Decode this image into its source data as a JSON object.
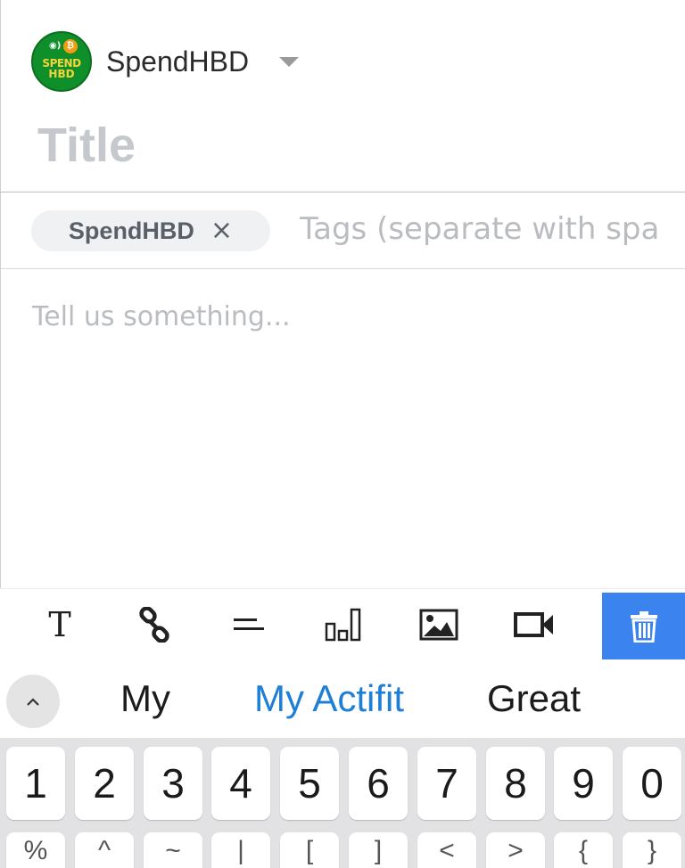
{
  "community": {
    "name": "SpendHBD",
    "logo_text_line1": "SPEND",
    "logo_text_line2": "HBD"
  },
  "editor": {
    "title_placeholder": "Title",
    "title_value": "",
    "tags": [
      {
        "label": "SpendHBD",
        "remove_symbol": "×"
      }
    ],
    "tags_placeholder": "Tags (separate with spa",
    "body_placeholder": "Tell us something...",
    "body_value": ""
  },
  "toolbar": {
    "items": [
      {
        "name": "text-format",
        "icon": "text-format-icon",
        "glyph": "T"
      },
      {
        "name": "link",
        "icon": "link-icon"
      },
      {
        "name": "divider",
        "icon": "divider-icon"
      },
      {
        "name": "poll",
        "icon": "poll-icon"
      },
      {
        "name": "image",
        "icon": "image-icon"
      },
      {
        "name": "video",
        "icon": "video-icon"
      },
      {
        "name": "delete",
        "icon": "trash-icon"
      }
    ],
    "delete_color": "#3b83ee"
  },
  "keyboard": {
    "suggestions": [
      "My",
      "My Actifit",
      "Great"
    ],
    "highlight_color": "#1e7fd4",
    "number_row": [
      "1",
      "2",
      "3",
      "4",
      "5",
      "6",
      "7",
      "8",
      "9",
      "0"
    ],
    "symbol_row": [
      "%",
      "^",
      "~",
      "|",
      "[",
      "]",
      "<",
      ">",
      "{",
      "}"
    ]
  }
}
